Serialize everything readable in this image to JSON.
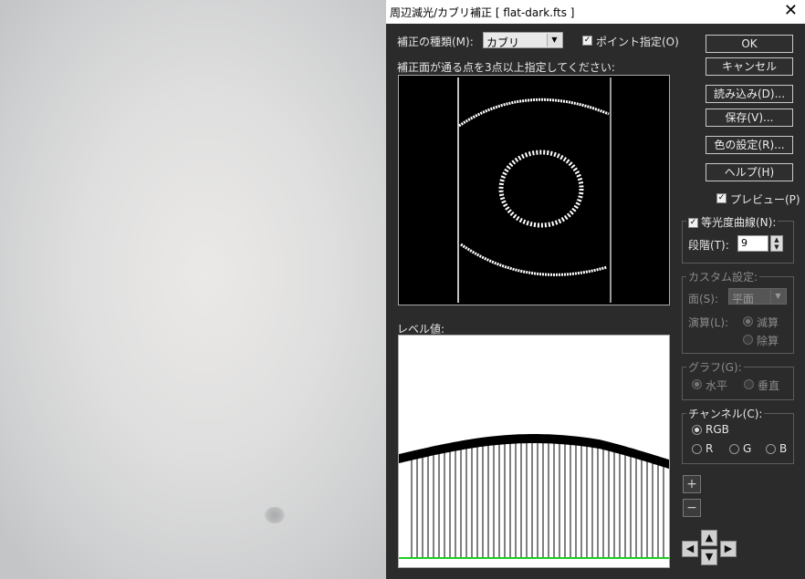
{
  "window": {
    "title": "周辺減光/カブリ補正 [ flat-dark.fts ]",
    "close_glyph": "✕"
  },
  "correction": {
    "type_label": "補正の種類(M):",
    "type_value": "カブリ",
    "point_spec_label": "ポイント指定(O)",
    "point_spec_checked": true,
    "points_instruction": "補正面が通る点を3点以上指定してください:"
  },
  "buttons": {
    "ok": "OK",
    "cancel": "キャンセル",
    "load": "読み込み(D)...",
    "save": "保存(V)...",
    "color": "色の設定(R)...",
    "help": "ヘルプ(H)"
  },
  "preview_option": {
    "label": "プレビュー(P)",
    "checked": true
  },
  "isophote": {
    "label": "等光度曲線(N):",
    "checked": true,
    "steps_label": "段階(T):",
    "steps_value": "9"
  },
  "custom": {
    "title": "カスタム設定:",
    "surface_label": "面(S):",
    "surface_value": "平面",
    "calc_label": "演算(L):",
    "subtract": "減算",
    "divide": "除算"
  },
  "graph": {
    "title": "グラフ(G):",
    "horizontal": "水平",
    "vertical": "垂直"
  },
  "channel": {
    "title": "チャンネル(C):",
    "rgb": "RGB",
    "r": "R",
    "g": "G",
    "b": "B",
    "selected": "RGB"
  },
  "level": {
    "label": "レベル値:"
  },
  "controls": {
    "plus": "+",
    "minus": "−",
    "up": "▲",
    "down": "▼",
    "left": "◀",
    "right": "▶"
  },
  "colors": {
    "dialog_bg": "#2b2b2b",
    "curve_baseline": "#22cc22"
  }
}
